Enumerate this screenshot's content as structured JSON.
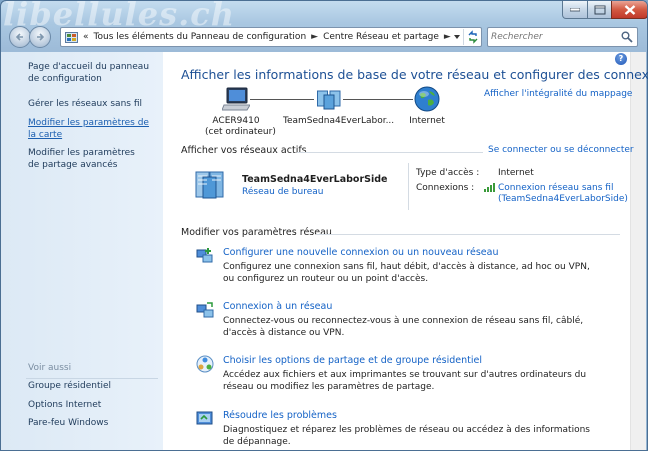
{
  "window": {
    "watermark": "libellules.ch",
    "buttons": {
      "minimize": "minimize",
      "maximize": "maximize",
      "close": "close"
    }
  },
  "address_bar": {
    "crumbs": [
      "Tous les éléments du Panneau de configuration",
      "Centre Réseau et partage"
    ],
    "overflow": "«"
  },
  "search": {
    "placeholder": "Rechercher"
  },
  "left_pane": {
    "links": [
      "Page d'accueil du panneau de configuration",
      "Gérer les réseaux sans fil",
      "Modifier les paramètres de la carte",
      "Modifier les paramètres de partage avancés"
    ],
    "see_also_label": "Voir aussi",
    "see_also": [
      "Groupe résidentiel",
      "Options Internet",
      "Pare-feu Windows"
    ]
  },
  "main": {
    "help": "?",
    "title": "Afficher les informations de base de votre réseau et configurer des connexions",
    "full_map_link": "Afficher l'intégralité du mappage",
    "map": {
      "computer_name": "ACER9410",
      "computer_sub": "(cet ordinateur)",
      "network_name": "TeamSedna4EverLabor...",
      "internet": "Internet"
    },
    "active_networks": {
      "heading": "Afficher vos réseaux actifs",
      "connect_link": "Se connecter ou se déconnecter",
      "name": "TeamSedna4EverLaborSide",
      "type": "Réseau de bureau",
      "access_type_label": "Type d'accès :",
      "access_type_value": "Internet",
      "connections_label": "Connexions :",
      "connection_line1": "Connexion réseau sans fil",
      "connection_line2": "(TeamSedna4EverLaborSide)"
    },
    "settings": {
      "heading": "Modifier vos paramètres réseau",
      "tasks": [
        {
          "title": "Configurer une nouvelle connexion ou un nouveau réseau",
          "desc": "Configurez une connexion sans fil, haut débit, d'accès à distance, ad hoc ou VPN, ou configurez un routeur ou un point d'accès."
        },
        {
          "title": "Connexion à un réseau",
          "desc": "Connectez-vous ou reconnectez-vous à une connexion de réseau sans fil, câblé, d'accès à distance ou VPN."
        },
        {
          "title": "Choisir les options de partage et de groupe résidentiel",
          "desc": "Accédez aux fichiers et aux imprimantes se trouvant sur d'autres ordinateurs du réseau ou modifiez les paramètres de partage."
        },
        {
          "title": "Résoudre les problèmes",
          "desc": "Diagnostiquez et réparez les problèmes de réseau ou accédez à des informations de dépannage."
        }
      ]
    }
  },
  "colors": {
    "link": "#1462c6",
    "title": "#1c4f94",
    "pane": "#dce9f5"
  }
}
